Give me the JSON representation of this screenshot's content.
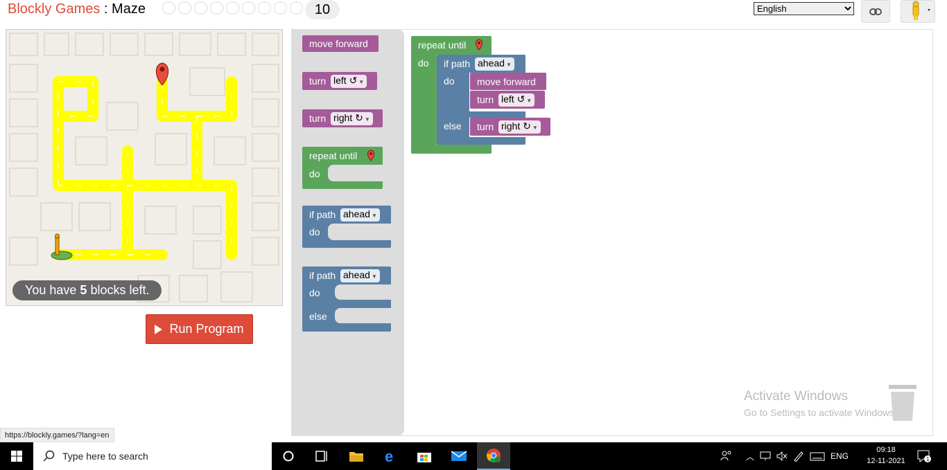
{
  "header": {
    "brand": "Blockly Games",
    "separator": " : ",
    "game": "Maze",
    "current_level": "10",
    "language": "English"
  },
  "maze": {
    "blocks_left_prefix": "You have ",
    "blocks_left_count": "5",
    "blocks_left_suffix": " blocks left."
  },
  "run_button": {
    "label": "Run Program"
  },
  "toolbox": {
    "move_forward": "move forward",
    "turn": "turn",
    "left_option": "left ↺",
    "right_option": "right ↻",
    "repeat_until": "repeat until",
    "do": "do",
    "if_path": "if path",
    "ahead_option": "ahead",
    "else": "else"
  },
  "program": {
    "repeat_until": "repeat until",
    "do": "do",
    "if_path": "if path",
    "ahead_option": "ahead",
    "if_do": "do",
    "move_forward": "move forward",
    "turn1": "turn",
    "turn1_option": "left ↺",
    "else": "else",
    "turn2": "turn",
    "turn2_option": "right ↻"
  },
  "watermark": {
    "line1": "Activate Windows",
    "line2": "Go to Settings to activate Windows."
  },
  "status_url": "https://blockly.games/?lang=en",
  "taskbar": {
    "search_placeholder": "Type here to search",
    "lang": "ENG",
    "time": "09:18",
    "date": "12-11-2021",
    "notifications": "1"
  },
  "colors": {
    "brand_red": "#dd4b39",
    "motion_purple": "#a55b99",
    "loop_green": "#5ba55b",
    "logic_blue": "#5b80a5",
    "path_yellow": "#ffff00"
  }
}
